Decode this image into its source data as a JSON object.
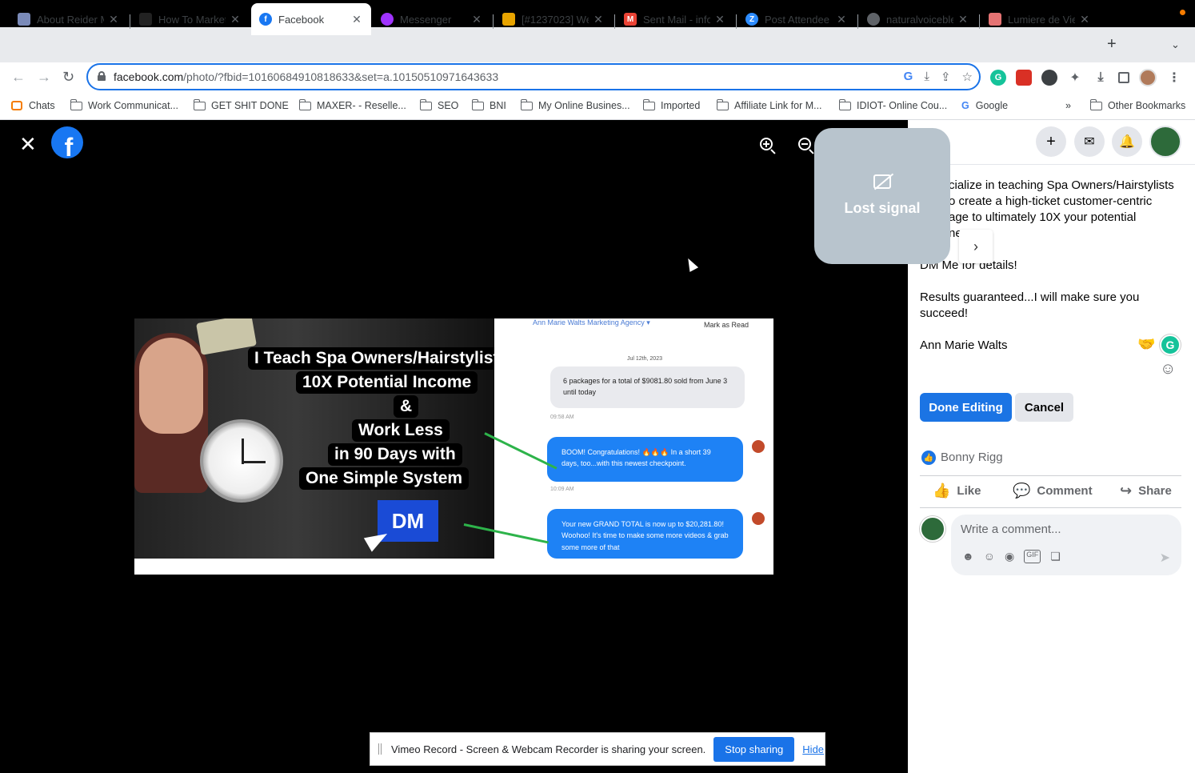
{
  "browser": {
    "tabs": [
      {
        "title": "About Reider M",
        "favicon_color": "#7a8ab8",
        "active": false
      },
      {
        "title": "How To Marketi",
        "favicon_color": "#222222",
        "active": false
      },
      {
        "title": "Facebook",
        "favicon_color": "#1877f2",
        "active": true
      },
      {
        "title": "Messenger",
        "favicon_color": "#a033ff",
        "active": false
      },
      {
        "title": "[#1237023] We",
        "favicon_color": "#e8a400",
        "active": false
      },
      {
        "title": "Sent Mail - info",
        "favicon_color": "#ea4335",
        "active": false
      },
      {
        "title": "Post Attendee",
        "favicon_color": "#2d8cff",
        "active": false
      },
      {
        "title": "naturalvoiceble",
        "favicon_color": "#5f6368",
        "active": false
      },
      {
        "title": "Lumiere de Vie",
        "favicon_color": "#e57373",
        "active": false
      }
    ],
    "close_glyph": "✕",
    "new_tab_glyph": "+",
    "tab_list_glyph": "⌄",
    "url_host": "facebook.com",
    "url_rest": "/photo/?fbid=10160684910818633&set=a.10150510971643633",
    "bookmarks": [
      {
        "label": "Chats",
        "icon": "chat-icon"
      },
      {
        "label": "Work Communicat...",
        "icon": "folder-icon"
      },
      {
        "label": "GET SHIT DONE",
        "icon": "folder-icon"
      },
      {
        "label": "MAXER- - Reselle...",
        "icon": "folder-icon"
      },
      {
        "label": "SEO",
        "icon": "folder-icon"
      },
      {
        "label": "BNI",
        "icon": "folder-icon"
      },
      {
        "label": "My Online Busines...",
        "icon": "folder-icon"
      },
      {
        "label": "Imported",
        "icon": "folder-icon"
      },
      {
        "label": "Affiliate Link for M...",
        "icon": "folder-icon"
      },
      {
        "label": "IDIOT- Online Cou...",
        "icon": "folder-icon"
      },
      {
        "label": "Google",
        "icon": "google-icon"
      }
    ],
    "bookmarks_overflow": "»",
    "other_bookmarks": "Other Bookmarks"
  },
  "viewer": {
    "close_glyph": "✕",
    "logo_letter": "f",
    "photo": {
      "headlines": [
        "I Teach Spa Owners/Hairstylists",
        "10X Potential Income",
        "&",
        "Work Less",
        "in 90 Days with",
        "One Simple System"
      ],
      "dm_label": "DM",
      "chat_header": "Ann Marie Walts Marketing Agency ▾",
      "mark_as_read": "Mark as Read",
      "chat_date": "Jul 12th, 2023",
      "grey_bubble": "6 packages for a total of $9081.80 sold from June 3 until today",
      "ts1": "09:58 AM",
      "blue_bubble_1": "BOOM! Congratulations! 🔥🔥🔥 In a short 39 days, too...with this newest checkpoint.",
      "ts2": "10:09 AM",
      "blue_bubble_2": "Your new GRAND TOTAL is now up to $20,281.80! Woohoo! It's time to make some more videos & grab some more of that"
    }
  },
  "lost_signal": {
    "label": "Lost signal"
  },
  "panel": {
    "post_line1": "cialize in teaching Spa Owners/Hairstylists",
    "post_line2": "o create a high-ticket customer-centric",
    "post_line3": "age to ultimately 10X your potential",
    "post_line4": "ne",
    "dm_line": "DM Me for details!",
    "results_line1": "Results guaranteed...I will make sure you",
    "results_line2": "succeed!",
    "signature": "Ann Marie Walts",
    "done_editing": "Done Editing",
    "cancel": "Cancel",
    "liker": "Bonny Rigg",
    "like": "Like",
    "comment": "Comment",
    "share": "Share",
    "comment_placeholder": "Write a comment...",
    "next_glyph": "›"
  },
  "share_bar": {
    "message": "Vimeo Record - Screen & Webcam Recorder is sharing your screen.",
    "stop": "Stop sharing",
    "hide": "Hide"
  }
}
